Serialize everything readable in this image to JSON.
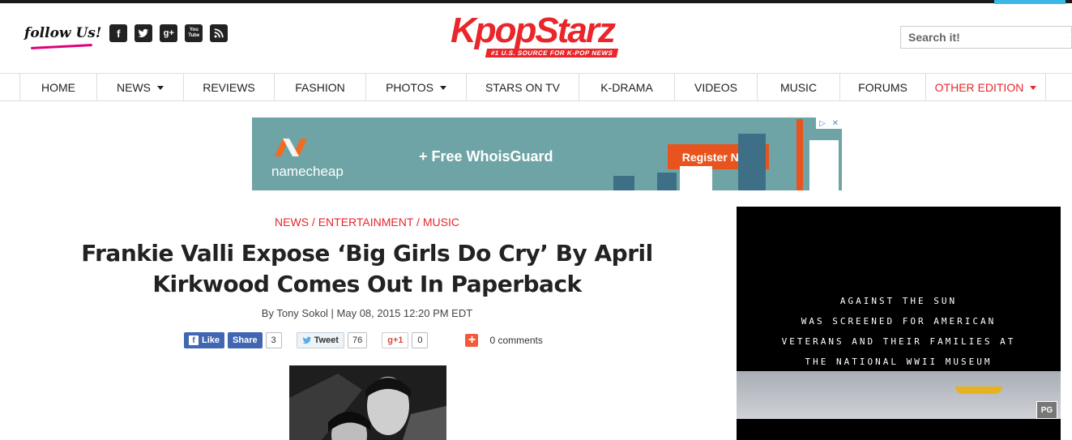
{
  "header": {
    "follow_label": "follow Us!",
    "social": [
      {
        "icon": "facebook-icon",
        "glyph": "f"
      },
      {
        "icon": "twitter-icon",
        "glyph": ""
      },
      {
        "icon": "google-plus-icon",
        "glyph": "g+"
      },
      {
        "icon": "youtube-icon",
        "glyph": "You Tube"
      },
      {
        "icon": "rss-icon",
        "glyph": ""
      }
    ],
    "logo_text": "KpopStarz",
    "logo_tagline": "#1 U.S. SOURCE FOR K-POP NEWS",
    "search_placeholder": "Search it!"
  },
  "nav": {
    "items": [
      {
        "label": "HOME",
        "dropdown": false
      },
      {
        "label": "NEWS",
        "dropdown": true
      },
      {
        "label": "REVIEWS",
        "dropdown": false
      },
      {
        "label": "FASHION",
        "dropdown": false
      },
      {
        "label": "PHOTOS",
        "dropdown": true
      },
      {
        "label": "STARS ON TV",
        "dropdown": false
      },
      {
        "label": "K-DRAMA",
        "dropdown": false
      },
      {
        "label": "VIDEOS",
        "dropdown": false
      },
      {
        "label": "MUSIC",
        "dropdown": false
      },
      {
        "label": "FORUMS",
        "dropdown": false
      },
      {
        "label": "OTHER EDITION",
        "dropdown": true,
        "accent": true
      }
    ]
  },
  "banner_ad": {
    "brand": "namecheap",
    "offer": "+ Free WhoisGuard",
    "cta": "Register Now"
  },
  "article": {
    "category": "NEWS / ENTERTAINMENT / MUSIC",
    "title": "Frankie Valli Expose ‘Big Girls Do Cry’ By April Kirkwood Comes Out In Paperback",
    "byline": "By Tony Sokol | May 08, 2015 12:20 PM EDT",
    "share": {
      "fb_like": "Like",
      "fb_share": "Share",
      "fb_count": "3",
      "tweet": "Tweet",
      "tweet_count": "76",
      "gplus": "+1",
      "gplus_count": "0",
      "comments": "0 comments"
    }
  },
  "side_ad": {
    "lines": [
      "AGAINST THE SUN",
      "WAS SCREENED FOR AMERICAN",
      "VETERANS AND THEIR FAMILIES AT",
      "THE NATIONAL WWII MUSEUM"
    ],
    "rating": "PG"
  },
  "colors": {
    "brand_red": "#e8262b",
    "facebook": "#4267b2",
    "namecheap_orange": "#e9541e",
    "ad_teal": "#6fa4a6"
  }
}
